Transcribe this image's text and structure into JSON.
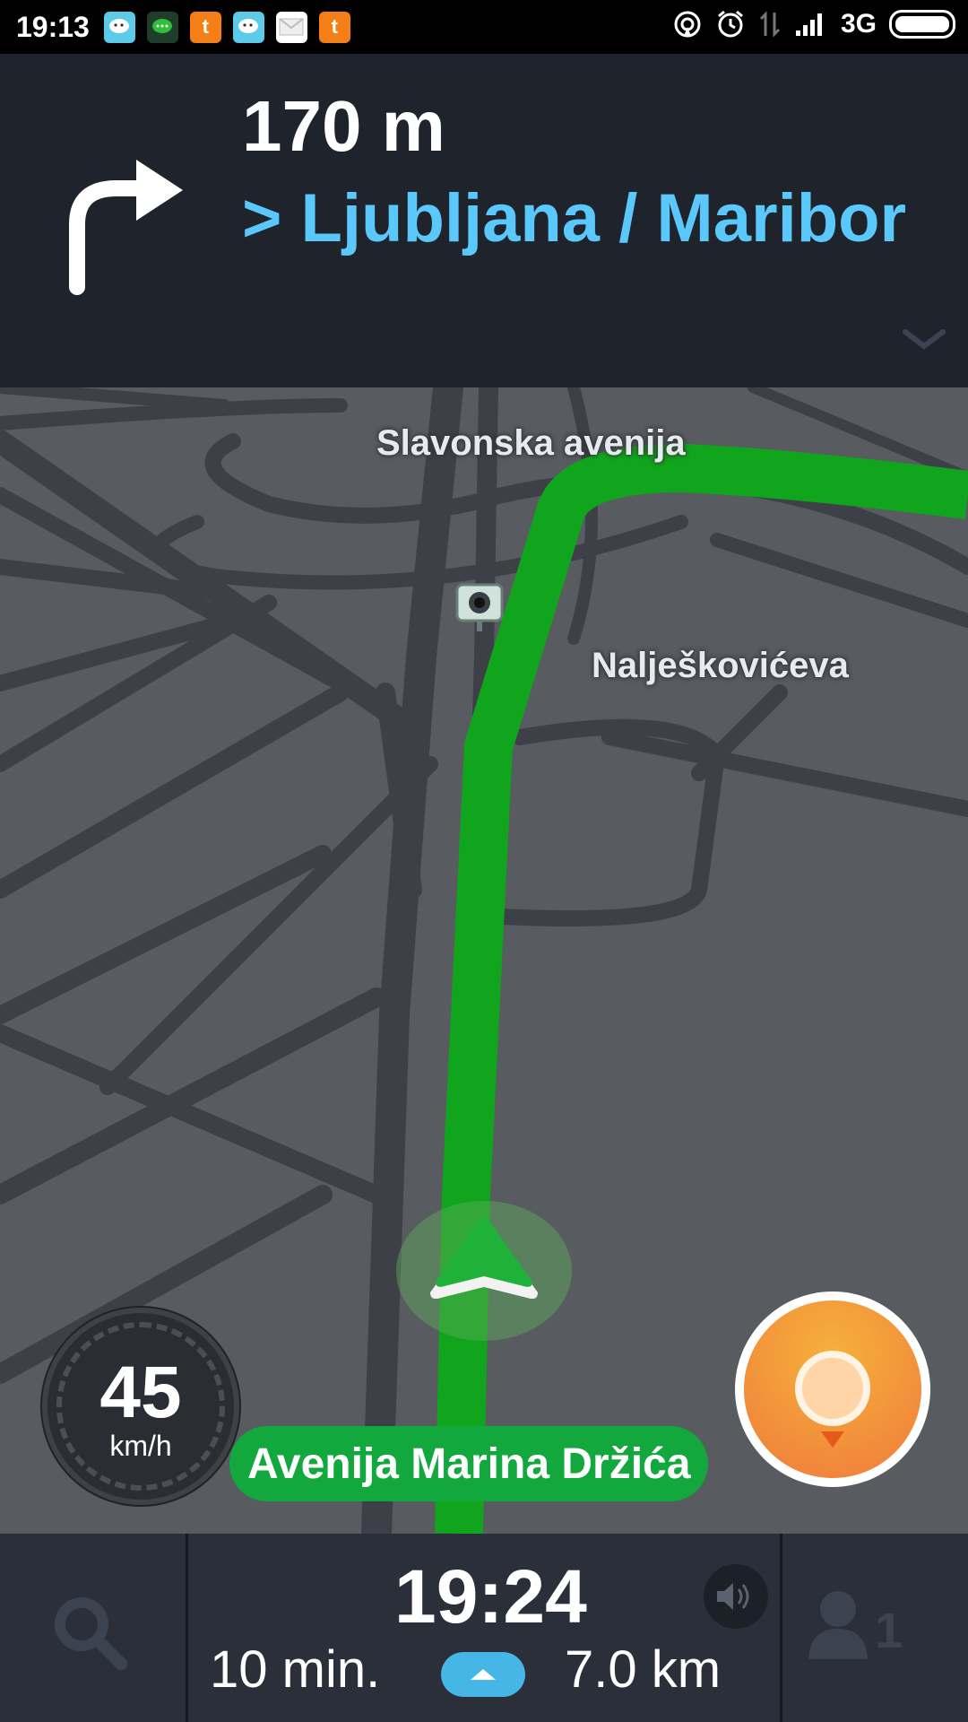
{
  "status_bar": {
    "time": "19:13",
    "network": "3G",
    "notification_icons": [
      "waze-icon",
      "chat-icon",
      "t-icon",
      "waze-icon",
      "mail-icon",
      "t-icon"
    ],
    "notification_t_letter": "t"
  },
  "instruction": {
    "distance": "170 m",
    "direction": "> Ljubljana / Maribor",
    "turn": "turn-right-icon",
    "direction_color": "#5ac8fa"
  },
  "map": {
    "labels": [
      "Slavonska avenija",
      "Nalješkovićeva"
    ],
    "route_color": "#10a51c"
  },
  "speed": {
    "value": "45",
    "unit": "km/h"
  },
  "current_street": "Avenija Marina Držića",
  "bottom_bar": {
    "eta": "19:24",
    "duration": "10 min.",
    "distance": "7.0 km",
    "users_count": "1"
  }
}
